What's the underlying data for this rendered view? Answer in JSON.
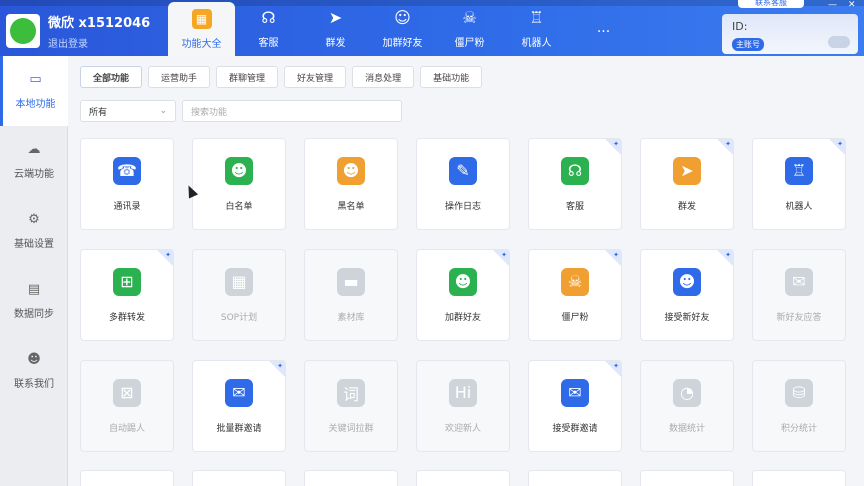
{
  "account": {
    "name": "微欣 x1512046",
    "sub": "退出登录"
  },
  "nav_tabs": [
    {
      "label": "功能大全",
      "icon": "grid-icon",
      "glyph": "▦"
    },
    {
      "label": "客服",
      "icon": "headset-icon",
      "glyph": "☊"
    },
    {
      "label": "群发",
      "icon": "send-icon",
      "glyph": "➤"
    },
    {
      "label": "加群好友",
      "icon": "add-friend-icon",
      "glyph": "☺"
    },
    {
      "label": "僵尸粉",
      "icon": "skull-icon",
      "glyph": "☠"
    },
    {
      "label": "机器人",
      "icon": "robot-icon",
      "glyph": "♖"
    },
    {
      "label": "...",
      "icon": "more-icon",
      "glyph": ""
    }
  ],
  "id_panel": {
    "label": "ID:",
    "badge": "主账号",
    "kefu": "联系客服"
  },
  "sidebar": [
    {
      "label": "本地功能",
      "icon": "monitor-icon",
      "glyph": "▭"
    },
    {
      "label": "云端功能",
      "icon": "cloud-icon",
      "glyph": "☁"
    },
    {
      "label": "基础设置",
      "icon": "gear-icon",
      "glyph": "⚙"
    },
    {
      "label": "数据同步",
      "icon": "sync-icon",
      "glyph": "▤"
    },
    {
      "label": "联系我们",
      "icon": "user-icon",
      "glyph": "☻"
    }
  ],
  "subtabs": [
    "全部功能",
    "运营助手",
    "群聊管理",
    "好友管理",
    "消息处理",
    "基础功能"
  ],
  "filter": {
    "select_value": "所有",
    "search_placeholder": "搜索功能"
  },
  "cards": [
    {
      "label": "通讯录",
      "icon": "contacts-icon",
      "glyph": "☎",
      "color": "#2f6be8",
      "pinned": false,
      "disabled": false
    },
    {
      "label": "白名单",
      "icon": "whitelist-icon",
      "glyph": "☻",
      "color": "#2cb150",
      "pinned": false,
      "disabled": false
    },
    {
      "label": "黑名单",
      "icon": "blacklist-icon",
      "glyph": "☻",
      "color": "#f0a030",
      "pinned": false,
      "disabled": false
    },
    {
      "label": "操作日志",
      "icon": "log-icon",
      "glyph": "✎",
      "color": "#2f6be8",
      "pinned": false,
      "disabled": false
    },
    {
      "label": "客服",
      "icon": "headset-icon",
      "glyph": "☊",
      "color": "#2cb150",
      "pinned": true,
      "disabled": false
    },
    {
      "label": "群发",
      "icon": "send-icon",
      "glyph": "➤",
      "color": "#f0a030",
      "pinned": true,
      "disabled": false
    },
    {
      "label": "机器人",
      "icon": "robot-icon",
      "glyph": "♖",
      "color": "#2f6be8",
      "pinned": true,
      "disabled": false
    },
    {
      "label": "多群转发",
      "icon": "forward-icon",
      "glyph": "⊞",
      "color": "#2cb150",
      "pinned": true,
      "disabled": false
    },
    {
      "label": "SOP计划",
      "icon": "sop-icon",
      "glyph": "▦",
      "color": "#cfd3da",
      "pinned": false,
      "disabled": true
    },
    {
      "label": "素材库",
      "icon": "folder-icon",
      "glyph": "▬",
      "color": "#cfd3da",
      "pinned": false,
      "disabled": true
    },
    {
      "label": "加群好友",
      "icon": "add-friend-icon",
      "glyph": "☻",
      "color": "#2cb150",
      "pinned": true,
      "disabled": false
    },
    {
      "label": "僵尸粉",
      "icon": "skull-icon",
      "glyph": "☠",
      "color": "#f0a030",
      "pinned": true,
      "disabled": false
    },
    {
      "label": "接受新好友",
      "icon": "accept-friend-icon",
      "glyph": "☻",
      "color": "#2f6be8",
      "pinned": true,
      "disabled": false
    },
    {
      "label": "新好友应答",
      "icon": "reply-icon",
      "glyph": "✉",
      "color": "#cfd3da",
      "pinned": false,
      "disabled": true
    },
    {
      "label": "自动踢人",
      "icon": "kick-icon",
      "glyph": "⊠",
      "color": "#cfd3da",
      "pinned": false,
      "disabled": true
    },
    {
      "label": "批量群邀请",
      "icon": "invite-icon",
      "glyph": "✉",
      "color": "#2f6be8",
      "pinned": true,
      "disabled": false
    },
    {
      "label": "关键词拉群",
      "icon": "keyword-icon",
      "glyph": "词",
      "color": "#cfd3da",
      "pinned": false,
      "disabled": true
    },
    {
      "label": "欢迎新人",
      "icon": "welcome-icon",
      "glyph": "Hi",
      "color": "#cfd3da",
      "pinned": false,
      "disabled": true
    },
    {
      "label": "接受群邀请",
      "icon": "accept-invite-icon",
      "glyph": "✉",
      "color": "#2f6be8",
      "pinned": true,
      "disabled": false
    },
    {
      "label": "数据统计",
      "icon": "pie-chart-icon",
      "glyph": "◔",
      "color": "#cfd3da",
      "pinned": false,
      "disabled": true
    },
    {
      "label": "积分统计",
      "icon": "points-icon",
      "glyph": "⛁",
      "color": "#cfd3da",
      "pinned": false,
      "disabled": true
    }
  ]
}
